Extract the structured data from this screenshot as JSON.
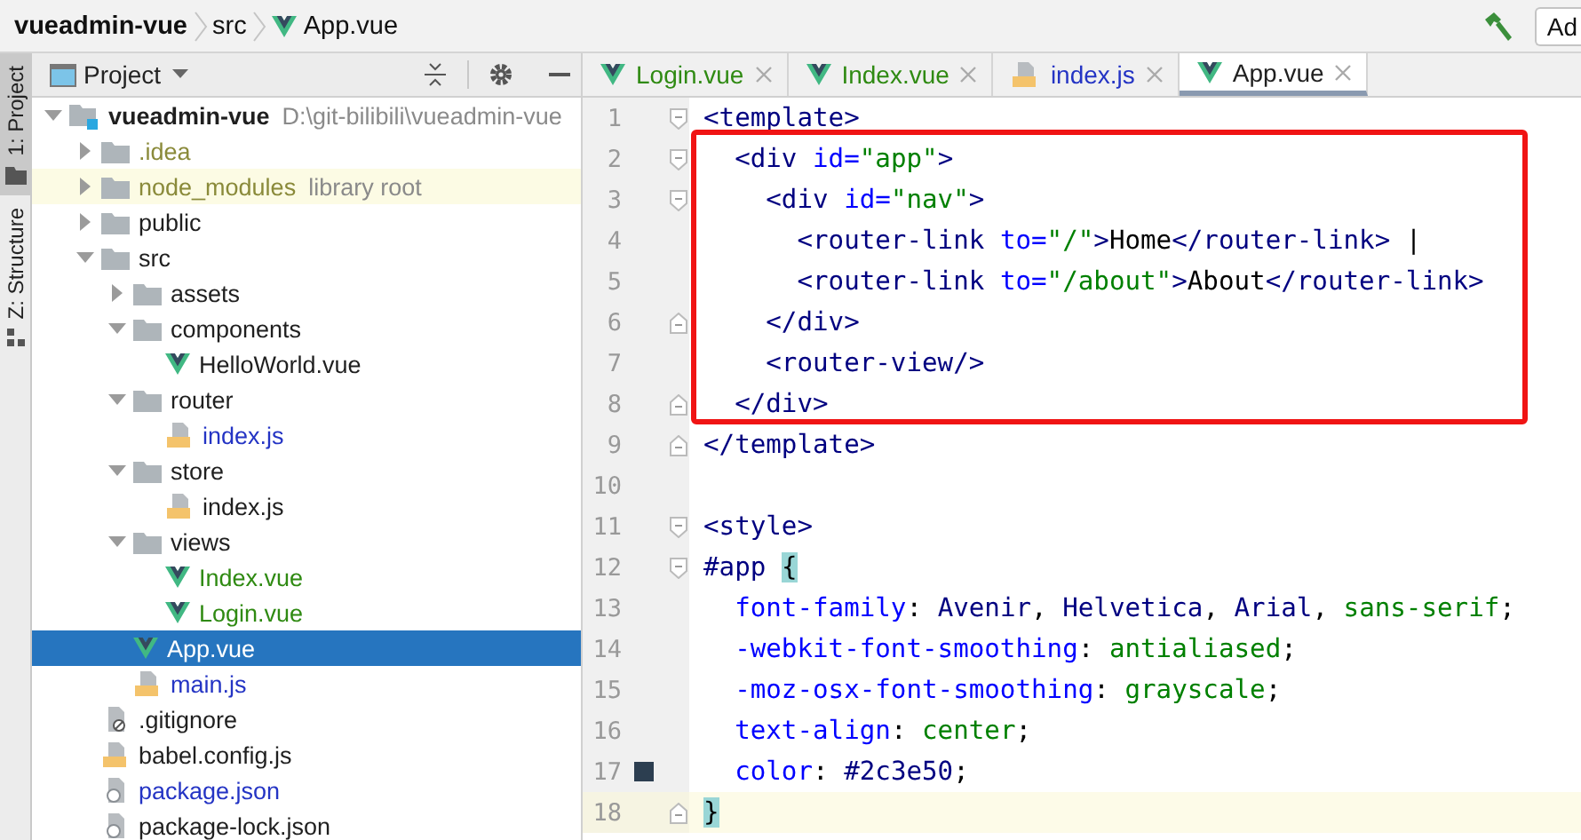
{
  "breadcrumb": [
    {
      "label": "vueadmin-vue",
      "kind": "project"
    },
    {
      "label": "src",
      "kind": "folder"
    },
    {
      "label": "App.vue",
      "kind": "vue"
    }
  ],
  "toolbar": {
    "button": "Ad"
  },
  "tool_strip": [
    {
      "label": "1: Project",
      "kind": "project",
      "selected": true
    },
    {
      "label": "Z: Structure",
      "kind": "structure",
      "selected": false
    }
  ],
  "project_panel": {
    "title": "Project",
    "tree": [
      {
        "name": "vueadmin-vue",
        "kind": "project",
        "note": "D:\\git-bilibili\\vueadmin-vue",
        "expanded": true,
        "selected": false,
        "library": false,
        "children": [
          {
            "name": ".idea",
            "kind": "folder",
            "color": "#8a8a3a",
            "expanded": false,
            "selected": false,
            "library": false
          },
          {
            "name": "node_modules",
            "kind": "folder",
            "note": "library root",
            "color": "#8a8a3a",
            "expanded": false,
            "selected": false,
            "library": true
          },
          {
            "name": "public",
            "kind": "folder",
            "expanded": false,
            "selected": false,
            "library": false
          },
          {
            "name": "src",
            "kind": "folder",
            "expanded": true,
            "selected": false,
            "library": false,
            "children": [
              {
                "name": "assets",
                "kind": "folder",
                "expanded": false,
                "selected": false,
                "library": false
              },
              {
                "name": "components",
                "kind": "folder",
                "expanded": true,
                "selected": false,
                "library": false,
                "children": [
                  {
                    "name": "HelloWorld.vue",
                    "kind": "vue",
                    "selected": false,
                    "library": false
                  }
                ]
              },
              {
                "name": "router",
                "kind": "folder",
                "expanded": true,
                "selected": false,
                "library": false,
                "children": [
                  {
                    "name": "index.js",
                    "kind": "js",
                    "color": "#2434c4",
                    "selected": false,
                    "library": false
                  }
                ]
              },
              {
                "name": "store",
                "kind": "folder",
                "expanded": true,
                "selected": false,
                "library": false,
                "children": [
                  {
                    "name": "index.js",
                    "kind": "js",
                    "selected": false,
                    "library": false
                  }
                ]
              },
              {
                "name": "views",
                "kind": "folder",
                "expanded": true,
                "selected": false,
                "library": false,
                "children": [
                  {
                    "name": "Index.vue",
                    "kind": "vue",
                    "color": "#2f8a12",
                    "selected": false,
                    "library": false
                  },
                  {
                    "name": "Login.vue",
                    "kind": "vue",
                    "color": "#2f8a12",
                    "selected": false,
                    "library": false
                  }
                ]
              },
              {
                "name": "App.vue",
                "kind": "vue",
                "selected": true,
                "library": false
              },
              {
                "name": "main.js",
                "kind": "js",
                "color": "#2434c4",
                "selected": false,
                "library": false
              }
            ]
          },
          {
            "name": ".gitignore",
            "kind": "gitignore",
            "selected": false,
            "library": false
          },
          {
            "name": "babel.config.js",
            "kind": "js",
            "selected": false,
            "library": false
          },
          {
            "name": "package.json",
            "kind": "json",
            "color": "#2434c4",
            "selected": false,
            "library": false
          },
          {
            "name": "package-lock.json",
            "kind": "json",
            "selected": false,
            "library": false
          }
        ]
      }
    ]
  },
  "tabs": [
    {
      "label": "Login.vue",
      "kind": "vue",
      "color": "#2f8a12",
      "selected": false
    },
    {
      "label": "Index.vue",
      "kind": "vue",
      "color": "#2f8a12",
      "selected": false
    },
    {
      "label": "index.js",
      "kind": "js",
      "color": "#2434c4",
      "selected": false
    },
    {
      "label": "App.vue",
      "kind": "vue",
      "selected": true
    }
  ],
  "code_blocks": [
    {
      "framed": false,
      "lines": [
        {
          "number": "1",
          "kind": "opener",
          "current": false,
          "tokens": [
            {
              "kind": "tag",
              "text": "<template>"
            }
          ]
        }
      ]
    },
    {
      "framed": true,
      "lines": [
        {
          "number": "2",
          "kind": "opener",
          "current": false,
          "tokens": [
            {
              "kind": "tag",
              "text": "  <div "
            },
            {
              "kind": "attr",
              "text": "id="
            },
            {
              "kind": "str",
              "text": "\"app\""
            },
            {
              "kind": "tag",
              "text": ">"
            }
          ]
        },
        {
          "number": "3",
          "kind": "opener",
          "current": false,
          "tokens": [
            {
              "kind": "tag",
              "text": "    <div "
            },
            {
              "kind": "attr",
              "text": "id="
            },
            {
              "kind": "str",
              "text": "\"nav\""
            },
            {
              "kind": "tag",
              "text": ">"
            }
          ]
        },
        {
          "number": "4",
          "kind": "plain",
          "current": false,
          "tokens": [
            {
              "kind": "tag",
              "text": "      <router-link "
            },
            {
              "kind": "attr",
              "text": "to="
            },
            {
              "kind": "str",
              "text": "\"/\""
            },
            {
              "kind": "tag",
              "text": ">"
            },
            {
              "kind": "plain",
              "text": "Home"
            },
            {
              "kind": "tag",
              "text": "</router-link>"
            },
            {
              "kind": "plain",
              "text": " |"
            }
          ]
        },
        {
          "number": "5",
          "kind": "plain",
          "current": false,
          "tokens": [
            {
              "kind": "tag",
              "text": "      <router-link "
            },
            {
              "kind": "attr",
              "text": "to="
            },
            {
              "kind": "str",
              "text": "\"/about\""
            },
            {
              "kind": "tag",
              "text": ">"
            },
            {
              "kind": "plain",
              "text": "About"
            },
            {
              "kind": "tag",
              "text": "</router-link>"
            }
          ]
        },
        {
          "number": "6",
          "kind": "closer",
          "current": false,
          "tokens": [
            {
              "kind": "tag",
              "text": "    </div>"
            }
          ]
        },
        {
          "number": "7",
          "kind": "plain",
          "current": false,
          "tokens": [
            {
              "kind": "tag",
              "text": "    <router-view/>"
            }
          ]
        },
        {
          "number": "8",
          "kind": "closer",
          "current": false,
          "tokens": [
            {
              "kind": "tag",
              "text": "  </div>"
            }
          ]
        }
      ]
    },
    {
      "framed": false,
      "lines": [
        {
          "number": "9",
          "kind": "closer",
          "current": false,
          "tokens": [
            {
              "kind": "tag",
              "text": "</template>"
            }
          ]
        },
        {
          "number": "10",
          "kind": "plain",
          "current": false
        },
        {
          "number": "11",
          "kind": "opener",
          "current": false,
          "tokens": [
            {
              "kind": "tag",
              "text": "<style>"
            }
          ]
        },
        {
          "number": "12",
          "kind": "opener",
          "current": false,
          "tokens": [
            {
              "kind": "tag",
              "text": "#app "
            },
            {
              "kind": "brace",
              "text": "{"
            }
          ]
        },
        {
          "number": "13",
          "kind": "plain",
          "current": false,
          "tokens": [
            {
              "kind": "prop",
              "text": "  font-family"
            },
            {
              "kind": "plain",
              "text": ": "
            },
            {
              "kind": "tag",
              "text": "Avenir"
            },
            {
              "kind": "plain",
              "text": ", "
            },
            {
              "kind": "tag",
              "text": "Helvetica"
            },
            {
              "kind": "plain",
              "text": ", "
            },
            {
              "kind": "tag",
              "text": "Arial"
            },
            {
              "kind": "plain",
              "text": ", "
            },
            {
              "kind": "str",
              "text": "sans-serif"
            },
            {
              "kind": "plain",
              "text": ";"
            }
          ]
        },
        {
          "number": "14",
          "kind": "plain",
          "current": false,
          "tokens": [
            {
              "kind": "prop",
              "text": "  -webkit-font-smoothing"
            },
            {
              "kind": "plain",
              "text": ": "
            },
            {
              "kind": "str",
              "text": "antialiased"
            },
            {
              "kind": "plain",
              "text": ";"
            }
          ]
        },
        {
          "number": "15",
          "kind": "plain",
          "current": false,
          "tokens": [
            {
              "kind": "prop",
              "text": "  -moz-osx-font-smoothing"
            },
            {
              "kind": "plain",
              "text": ": "
            },
            {
              "kind": "str",
              "text": "grayscale"
            },
            {
              "kind": "plain",
              "text": ";"
            }
          ]
        },
        {
          "number": "16",
          "kind": "plain",
          "current": false,
          "tokens": [
            {
              "kind": "prop",
              "text": "  text-align"
            },
            {
              "kind": "plain",
              "text": ": "
            },
            {
              "kind": "str",
              "text": "center"
            },
            {
              "kind": "plain",
              "text": ";"
            }
          ]
        },
        {
          "number": "17",
          "kind": "plain",
          "current": false,
          "tokens": [
            {
              "kind": "prop",
              "text": "  color"
            },
            {
              "kind": "plain",
              "text": ": "
            },
            {
              "kind": "color",
              "text": "#2c3e50"
            },
            {
              "kind": "plain",
              "text": ";"
            }
          ]
        },
        {
          "number": "18",
          "kind": "closer",
          "current": true,
          "tokens": [
            {
              "kind": "brace",
              "text": "}"
            }
          ]
        }
      ]
    }
  ]
}
